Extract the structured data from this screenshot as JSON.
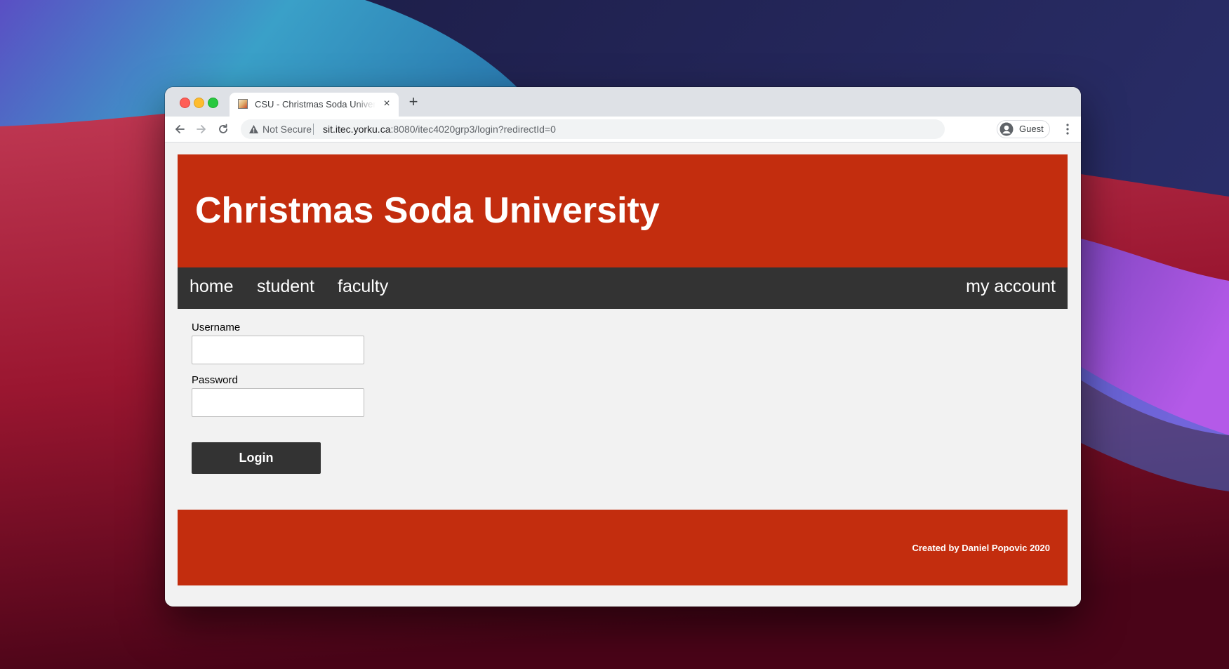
{
  "browser": {
    "tab_title": "CSU - Christmas Soda University",
    "tab_close_symbol": "×",
    "new_tab_symbol": "+",
    "security_label": "Not Secure",
    "url_host": "sit.itec.yorku.ca",
    "url_rest": ":8080/itec4020grp3/login?redirectId=0",
    "profile_name": "Guest",
    "icons": {
      "back": "arrow-left-icon",
      "forward": "arrow-right-icon",
      "reload": "reload-icon",
      "warning": "warning-triangle-icon",
      "avatar": "user-avatar-icon",
      "menu": "kebab-menu-icon"
    }
  },
  "site": {
    "title": "Christmas Soda University",
    "nav": {
      "home": "home",
      "student": "student",
      "faculty": "faculty",
      "account": "my account"
    },
    "form": {
      "username_label": "Username",
      "username_value": "",
      "password_label": "Password",
      "password_value": "",
      "login_button": "Login"
    },
    "footer": "Created by Daniel Popovic 2020"
  },
  "colors": {
    "brand_red": "#c32d0e",
    "nav_dark": "#333333",
    "page_bg": "#f2f2f2"
  }
}
